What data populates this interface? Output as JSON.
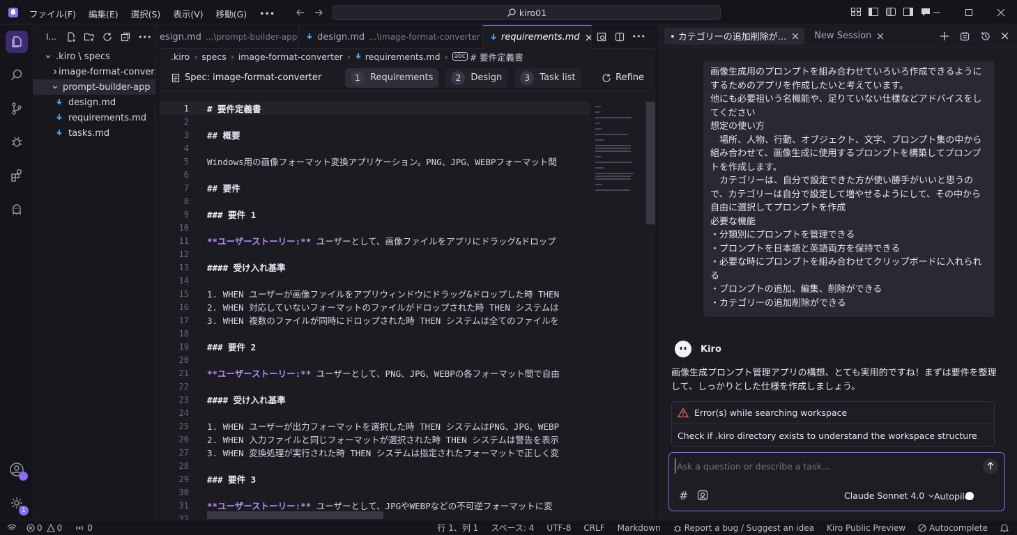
{
  "titlebar": {
    "menus": [
      "ファイル(F)",
      "編集(E)",
      "選択(S)",
      "表示(V)",
      "移動(G)"
    ],
    "more": "•••",
    "search_text": "kiro01"
  },
  "explorer": {
    "header": "I...",
    "more": "•••",
    "tree": [
      {
        "label": ".kiro \\ specs",
        "depth": 0,
        "type": "folder-open"
      },
      {
        "label": "image-format-conver...",
        "depth": 1,
        "type": "folder-closed"
      },
      {
        "label": "prompt-builder-app",
        "depth": 1,
        "type": "folder-open",
        "selected": true
      },
      {
        "label": "design.md",
        "depth": 2,
        "type": "file"
      },
      {
        "label": "requirements.md",
        "depth": 2,
        "type": "file"
      },
      {
        "label": "tasks.md",
        "depth": 2,
        "type": "file"
      }
    ]
  },
  "editor": {
    "tabs": [
      {
        "name": "esign.md",
        "path": "...\\prompt-builder-app"
      },
      {
        "name": "design.md",
        "path": "...\\image-format-converter"
      },
      {
        "name": "requirements.md",
        "path": ""
      }
    ],
    "more": "•••",
    "breadcrumb": [
      ".kiro",
      "specs",
      "image-format-converter",
      "requirements.md",
      "# 要件定義書"
    ],
    "spec_title": "Spec: image-format-converter",
    "steps": [
      {
        "num": "1",
        "label": "Requirements"
      },
      {
        "num": "2",
        "label": "Design"
      },
      {
        "num": "3",
        "label": "Task list"
      }
    ],
    "refine_label": "Refine",
    "lines": [
      {
        "n": "1",
        "t": "# 要件定義書",
        "k": "h"
      },
      {
        "n": "2",
        "t": "",
        "k": "p"
      },
      {
        "n": "3",
        "t": "## 概要",
        "k": "h"
      },
      {
        "n": "4",
        "t": "",
        "k": "p"
      },
      {
        "n": "5",
        "t": "Windows用の画像フォーマット変換アプリケーション。PNG、JPG、WEBPフォーマット間",
        "k": "p"
      },
      {
        "n": "6",
        "t": "",
        "k": "p"
      },
      {
        "n": "7",
        "t": "## 要件",
        "k": "h"
      },
      {
        "n": "8",
        "t": "",
        "k": "p"
      },
      {
        "n": "9",
        "t": "### 要件 1",
        "k": "h"
      },
      {
        "n": "10",
        "t": "",
        "k": "p"
      },
      {
        "n": "11",
        "b": "**ユーザーストーリー:**",
        "t": " ユーザーとして、画像ファイルをアプリにドラッグ&ドロップ",
        "k": "s"
      },
      {
        "n": "12",
        "t": "",
        "k": "p"
      },
      {
        "n": "13",
        "t": "#### 受け入れ基準",
        "k": "h"
      },
      {
        "n": "14",
        "t": "",
        "k": "p"
      },
      {
        "n": "15",
        "t": "1. WHEN ユーザーが画像ファイルをアプリウィンドウにドラッグ&ドロップした時 THEN",
        "k": "p"
      },
      {
        "n": "16",
        "t": "2. WHEN 対応していないフォーマットのファイルがドロップされた時 THEN システムは",
        "k": "p"
      },
      {
        "n": "17",
        "t": "3. WHEN 複数のファイルが同時にドロップされた時 THEN システムは全てのファイルを",
        "k": "p"
      },
      {
        "n": "18",
        "t": "",
        "k": "p"
      },
      {
        "n": "19",
        "t": "### 要件 2",
        "k": "h"
      },
      {
        "n": "20",
        "t": "",
        "k": "p"
      },
      {
        "n": "21",
        "b": "**ユーザーストーリー:**",
        "t": " ユーザーとして、PNG、JPG、WEBPの各フォーマット間で自由",
        "k": "s"
      },
      {
        "n": "22",
        "t": "",
        "k": "p"
      },
      {
        "n": "23",
        "t": "#### 受け入れ基準",
        "k": "h"
      },
      {
        "n": "24",
        "t": "",
        "k": "p"
      },
      {
        "n": "25",
        "t": "1. WHEN ユーザーが出力フォーマットを選択した時 THEN システムはPNG、JPG、WEBP",
        "k": "p"
      },
      {
        "n": "26",
        "t": "2. WHEN 入力ファイルと同じフォーマットが選択された時 THEN システムは警告を表示",
        "k": "p"
      },
      {
        "n": "27",
        "t": "3. WHEN 変換処理が実行された時 THEN システムは指定されたフォーマットで正しく変",
        "k": "p"
      },
      {
        "n": "28",
        "t": "",
        "k": "p"
      },
      {
        "n": "29",
        "t": "### 要件 3",
        "k": "h"
      },
      {
        "n": "30",
        "t": "",
        "k": "p"
      },
      {
        "n": "31",
        "b": "**ユーザーストーリー:**",
        "t": " ユーザーとして、JPGやWEBPなどの不可逆フォーマットに変",
        "k": "s"
      },
      {
        "n": "32",
        "t": "",
        "k": "p"
      }
    ]
  },
  "chat": {
    "tabs": [
      {
        "label": "• カテゴリーの追加削除が...",
        "active": true
      },
      {
        "label": "New Session",
        "active": false
      }
    ],
    "user_message": [
      "画像生成用のプロンプトを組み合わせていろいろ作成できるようにするためのアプリを作成したいと考えています。",
      "他にも必要祖いう名機能や、足りていない仕様などアドバイスをしてください",
      "想定の使い方",
      "　場所、人物、行動、オブジェクト、文字、プロンプト集の中から組み合わせて、画像生成に使用するプロンプトを構築してプロンプトを作成します。",
      "　カテゴリーは、自分で設定できた方が使い勝手がいいと思うので、カテゴリーは自分で設定して増やせるようにして、その中から自由に選択してプロンプトを作成",
      "必要な機能",
      "・分類別にプロンプトを管理できる",
      "・プロンプトを日本語と英語両方を保持できる",
      "・必要な時にプロンプトを組み合わせてクリップボードに入れられる",
      "・プロンプトの追加、編集、削除ができる",
      "・カテゴリーの追加削除ができる"
    ],
    "assistant_name": "Kiro",
    "assistant_message": "画像生成プロンプト管理アプリの構想、とても実用的ですね！まずは要件を整理して、しっかりとした仕様を作成しましょう。",
    "tool_error": "Error(s) while searching workspace",
    "tool_step": "Check if .kiro directory exists to understand the workspace structure",
    "input_placeholder": "Ask a question or describe a task...",
    "model": "Claude Sonnet 4.0",
    "autopilot_label": "Autopilot"
  },
  "statusbar": {
    "errors": "0",
    "warnings": "0",
    "ports": "0",
    "position": "行 1、列 1",
    "spaces": "スペース: 4",
    "encoding": "UTF-8",
    "eol": "CRLF",
    "language": "Markdown",
    "report": "Report a bug / Suggest an idea",
    "preview": "Kiro Public Preview",
    "autocomplete": "Autocomplete"
  },
  "activity": {
    "settings_badge": "1"
  },
  "colors": {
    "accent": "#8a6cf0",
    "background": "#1c1b22",
    "error": "#f0605e"
  }
}
